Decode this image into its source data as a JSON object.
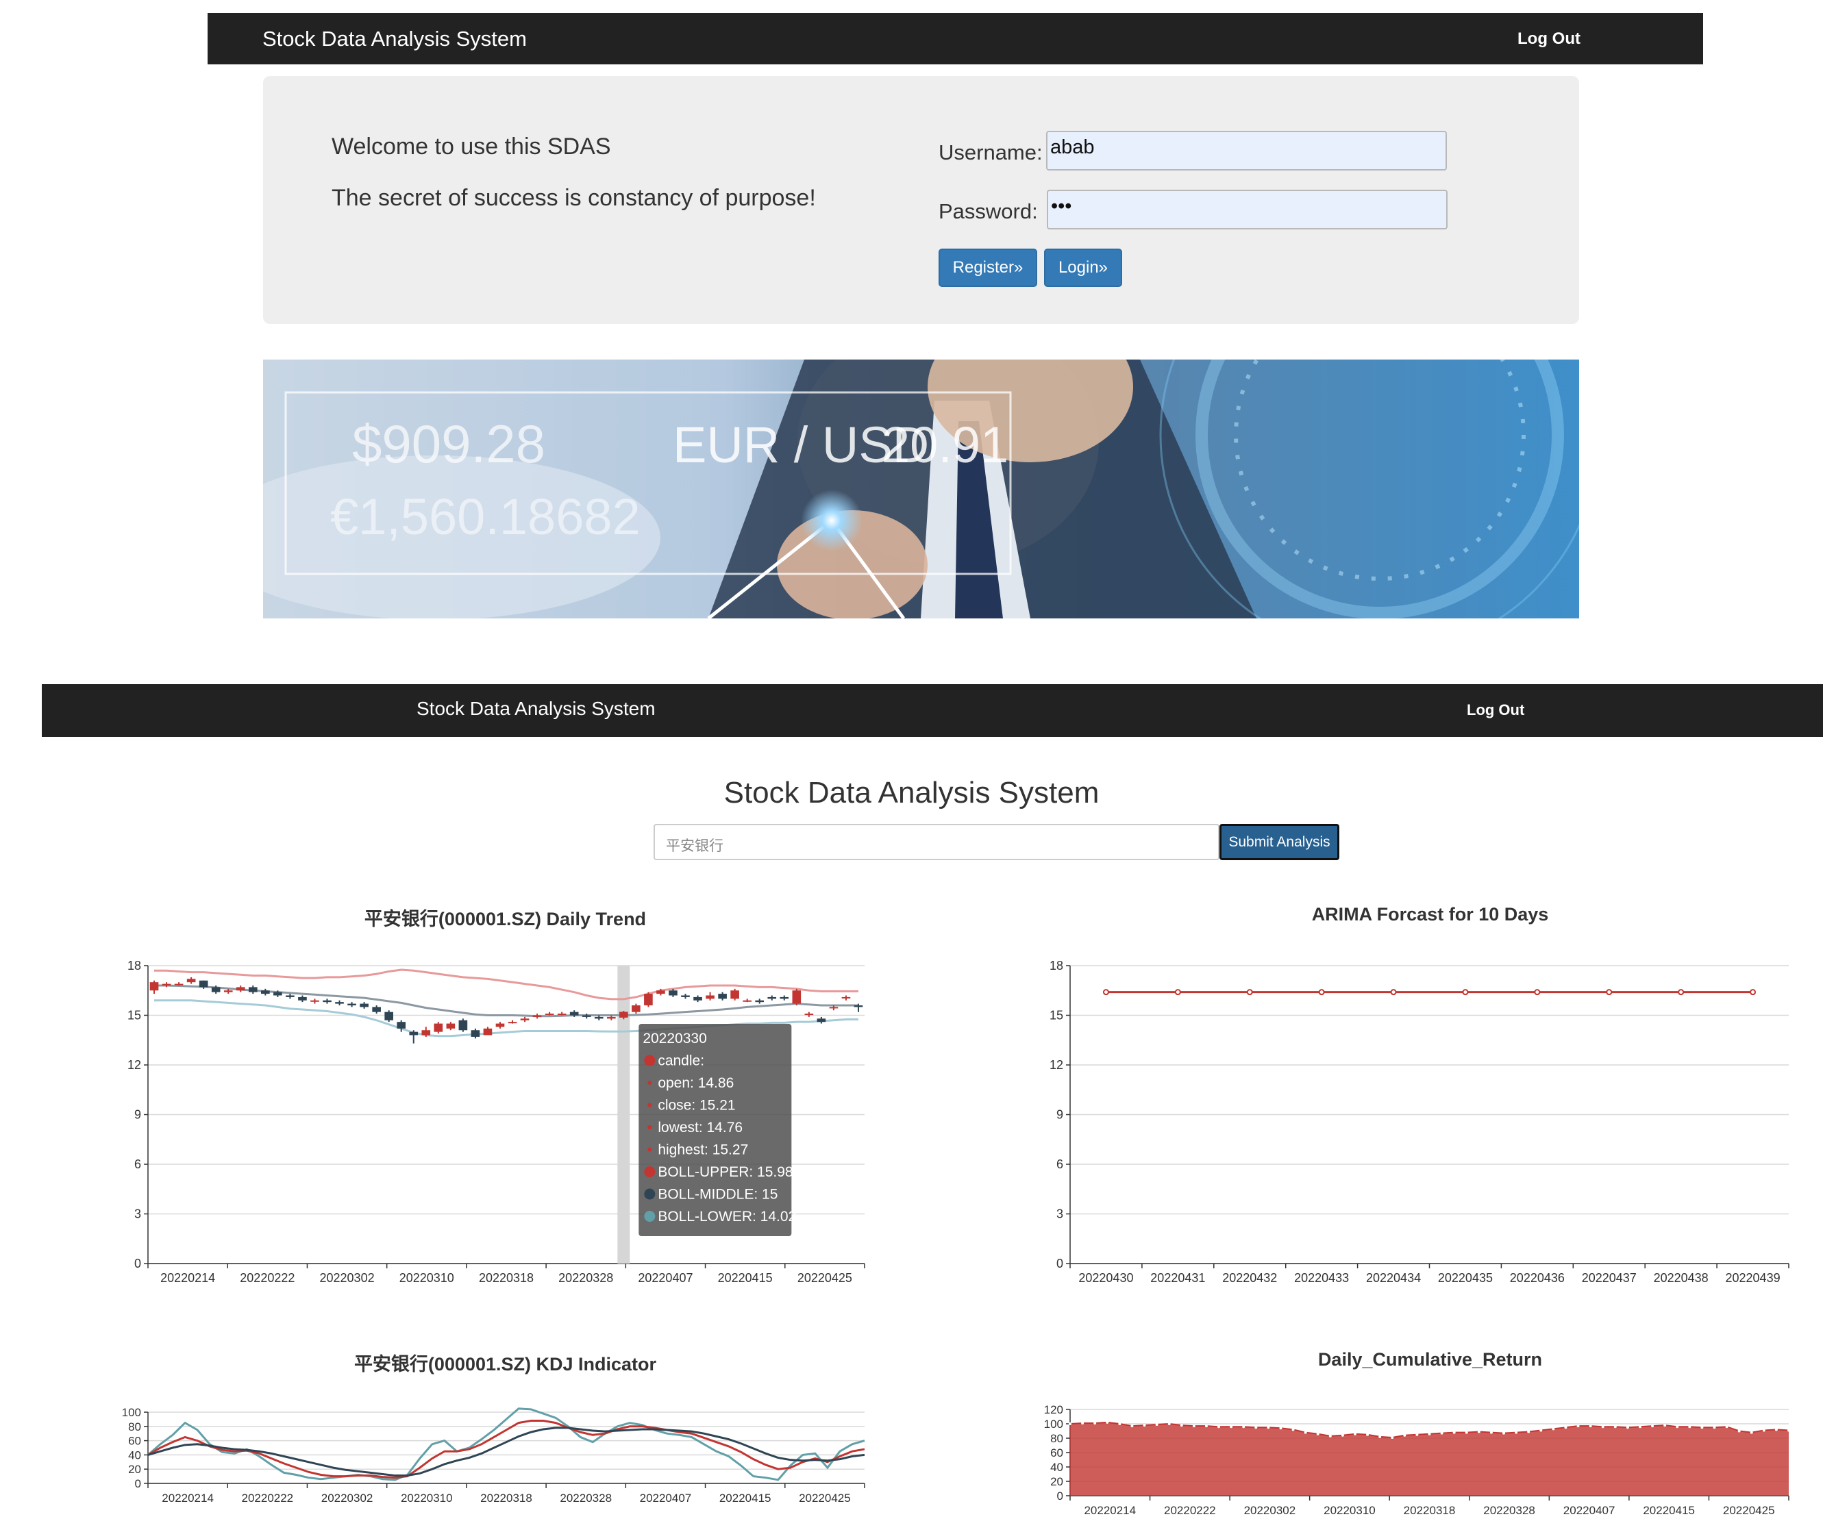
{
  "login_screen": {
    "navbar": {
      "brand": "Stock Data Analysis System",
      "logout": "Log Out"
    },
    "jumbotron": {
      "welcome": "Welcome to use this SDAS",
      "motto": "The secret of success is constancy of purpose!",
      "username_label": "Username:",
      "username_value": "abab",
      "password_label": "Password:",
      "password_value": "•••",
      "register_button": "Register»",
      "login_button": "Login»"
    },
    "banner": {
      "line1": "$909.28",
      "line2": "EUR / USD",
      "line3": "20.91",
      "line4": "€1,560.18682"
    }
  },
  "analysis_screen": {
    "navbar": {
      "brand": "Stock Data Analysis System",
      "logout": "Log Out"
    },
    "title": "Stock Data Analysis System",
    "search": {
      "value": "平安银行",
      "submit": "Submit Analysis"
    },
    "colors": {
      "red": "#c23531",
      "dark": "#2f4554",
      "teal": "#61a0a8",
      "upper": "#e8999a",
      "lower": "#a5cbd7",
      "middle": "#8c98a2"
    }
  },
  "chart_data": [
    {
      "type": "candlestick",
      "title": "平安银行(000001.SZ) Daily Trend",
      "xticks": [
        "20220214",
        "20220222",
        "20220302",
        "20220310",
        "20220318",
        "20220328",
        "20220407",
        "20220415",
        "20220425"
      ],
      "yticks": [
        "0",
        "3",
        "6",
        "9",
        "12",
        "15",
        "18"
      ],
      "ylim": [
        0,
        18
      ],
      "open": [
        16.5,
        16.8,
        16.9,
        17.0,
        17.1,
        16.7,
        16.4,
        16.5,
        16.7,
        16.5,
        16.4,
        16.2,
        16.1,
        15.9,
        15.9,
        15.8,
        15.7,
        15.7,
        15.5,
        15.2,
        14.6,
        14.0,
        13.8,
        14.0,
        14.2,
        14.7,
        14.1,
        13.8,
        14.3,
        14.6,
        14.7,
        14.9,
        15.1,
        15.1,
        15.2,
        15.0,
        14.9,
        14.8,
        14.86,
        15.2,
        15.6,
        16.3,
        16.5,
        16.2,
        16.1,
        16.0,
        16.3,
        16.0,
        15.9,
        15.9,
        16.1,
        16.1,
        15.7,
        15.1,
        14.8,
        15.5,
        16.1,
        15.6
      ],
      "close": [
        17.0,
        16.9,
        16.9,
        17.2,
        16.7,
        16.4,
        16.5,
        16.7,
        16.4,
        16.3,
        16.2,
        16.1,
        15.9,
        15.9,
        15.8,
        15.7,
        15.6,
        15.5,
        15.2,
        14.7,
        14.2,
        13.8,
        14.1,
        14.5,
        14.5,
        14.1,
        13.7,
        14.2,
        14.5,
        14.6,
        14.8,
        15.0,
        15.1,
        15.1,
        15.0,
        14.9,
        14.8,
        14.9,
        15.21,
        15.6,
        16.3,
        16.5,
        16.2,
        16.1,
        15.9,
        16.2,
        16.0,
        16.5,
        15.9,
        15.8,
        16.0,
        16.0,
        16.5,
        15.1,
        14.6,
        15.5,
        16.1,
        15.5
      ],
      "low": [
        16.3,
        16.7,
        16.8,
        16.9,
        16.6,
        16.3,
        16.3,
        16.4,
        16.3,
        16.2,
        16.1,
        16.0,
        15.8,
        15.7,
        15.7,
        15.6,
        15.5,
        15.4,
        15.1,
        14.6,
        14.0,
        13.3,
        13.7,
        13.9,
        14.1,
        14.0,
        13.6,
        13.8,
        14.2,
        14.5,
        14.6,
        14.8,
        15.0,
        15.0,
        14.9,
        14.8,
        14.7,
        14.7,
        14.76,
        15.1,
        15.5,
        16.2,
        16.1,
        16.0,
        15.8,
        15.9,
        15.9,
        15.9,
        15.8,
        15.7,
        15.9,
        15.9,
        15.6,
        14.9,
        14.5,
        15.3,
        15.9,
        15.2
      ],
      "high": [
        17.1,
        17.0,
        17.0,
        17.3,
        17.1,
        16.8,
        16.6,
        16.8,
        16.8,
        16.6,
        16.5,
        16.3,
        16.2,
        16.0,
        16.0,
        15.9,
        15.8,
        15.8,
        15.6,
        15.3,
        14.7,
        14.1,
        14.3,
        14.6,
        14.6,
        14.8,
        14.2,
        14.3,
        14.6,
        14.7,
        14.9,
        15.1,
        15.2,
        15.2,
        15.3,
        15.1,
        15.0,
        15.0,
        15.27,
        15.7,
        16.4,
        16.6,
        16.6,
        16.3,
        16.2,
        16.4,
        16.4,
        16.6,
        16.0,
        16.0,
        16.2,
        16.2,
        16.6,
        15.2,
        14.9,
        15.6,
        16.2,
        15.7
      ],
      "boll_upper": [
        17.7,
        17.7,
        17.65,
        17.6,
        17.6,
        17.55,
        17.5,
        17.45,
        17.4,
        17.4,
        17.35,
        17.3,
        17.25,
        17.25,
        17.3,
        17.3,
        17.35,
        17.4,
        17.5,
        17.65,
        17.75,
        17.7,
        17.6,
        17.5,
        17.4,
        17.3,
        17.25,
        17.2,
        17.1,
        17.0,
        16.9,
        16.8,
        16.7,
        16.55,
        16.4,
        16.2,
        16.05,
        15.98,
        15.98,
        16.1,
        16.3,
        16.5,
        16.6,
        16.7,
        16.75,
        16.8,
        16.8,
        16.8,
        16.75,
        16.7,
        16.7,
        16.65,
        16.6,
        16.5,
        16.45,
        16.45,
        16.45,
        16.45
      ],
      "boll_middle": [
        16.8,
        16.8,
        16.78,
        16.75,
        16.72,
        16.68,
        16.62,
        16.55,
        16.5,
        16.45,
        16.4,
        16.35,
        16.3,
        16.25,
        16.2,
        16.15,
        16.1,
        16.05,
        15.95,
        15.85,
        15.75,
        15.6,
        15.45,
        15.35,
        15.25,
        15.15,
        15.05,
        15.0,
        15.0,
        15.0,
        14.98,
        14.95,
        14.95,
        14.97,
        15.0,
        15.0,
        15.0,
        15.0,
        15.0,
        15.02,
        15.05,
        15.1,
        15.15,
        15.2,
        15.25,
        15.3,
        15.35,
        15.42,
        15.5,
        15.55,
        15.6,
        15.65,
        15.7,
        15.65,
        15.6,
        15.6,
        15.6,
        15.6
      ],
      "boll_lower": [
        15.9,
        15.9,
        15.9,
        15.9,
        15.85,
        15.8,
        15.75,
        15.7,
        15.65,
        15.6,
        15.5,
        15.4,
        15.35,
        15.3,
        15.25,
        15.15,
        15.05,
        14.9,
        14.7,
        14.45,
        14.2,
        13.95,
        13.8,
        13.75,
        13.75,
        13.8,
        13.85,
        13.9,
        13.95,
        14.0,
        14.05,
        14.05,
        14.05,
        14.05,
        14.05,
        14.05,
        14.03,
        14.02,
        14.02,
        14.05,
        14.1,
        14.15,
        14.2,
        14.25,
        14.3,
        14.35,
        14.4,
        14.45,
        14.5,
        14.5,
        14.55,
        14.55,
        14.6,
        14.6,
        14.65,
        14.7,
        14.75,
        14.75
      ],
      "tooltip": [
        "20220330",
        "candle:",
        "open: 14.86",
        "close: 15.21",
        "lowest: 14.76",
        "highest: 15.27",
        "BOLL-UPPER: 15.98",
        "BOLL-MIDDLE: 15",
        "BOLL-LOWER: 14.02"
      ],
      "tooltip_index": 38
    },
    {
      "type": "line",
      "title": "ARIMA Forcast for 10 Days",
      "categories": [
        "20220430",
        "20220431",
        "20220432",
        "20220433",
        "20220434",
        "20220435",
        "20220436",
        "20220437",
        "20220438",
        "20220439"
      ],
      "values": [
        16.4,
        16.4,
        16.4,
        16.4,
        16.4,
        16.4,
        16.4,
        16.4,
        16.4,
        16.4
      ],
      "yticks": [
        "0",
        "3",
        "6",
        "9",
        "12",
        "15",
        "18"
      ],
      "ylim": [
        0,
        18
      ]
    },
    {
      "type": "line",
      "title": "平安银行(000001.SZ) KDJ Indicator",
      "xticks": [
        "20220214",
        "20220222",
        "20220302",
        "20220310",
        "20220318",
        "20220328",
        "20220407",
        "20220415",
        "20220425"
      ],
      "yticks": [
        "0",
        "20",
        "40",
        "60",
        "80",
        "100"
      ],
      "ylim": [
        0,
        100
      ],
      "series": [
        {
          "values": [
            40,
            55,
            68,
            85,
            75,
            55,
            44,
            42,
            48,
            38,
            26,
            15,
            12,
            8,
            6,
            8,
            10,
            12,
            10,
            6,
            5,
            12,
            35,
            55,
            60,
            45,
            50,
            62,
            75,
            90,
            105,
            104,
            98,
            92,
            80,
            65,
            58,
            70,
            80,
            85,
            82,
            75,
            70,
            68,
            65,
            55,
            45,
            38,
            25,
            10,
            8,
            5,
            25,
            40,
            42,
            22,
            45,
            55,
            60
          ]
        },
        {
          "values": [
            40,
            50,
            58,
            65,
            60,
            52,
            47,
            45,
            46,
            42,
            35,
            28,
            22,
            16,
            12,
            10,
            10,
            11,
            11,
            9,
            8,
            10,
            22,
            35,
            45,
            45,
            48,
            55,
            65,
            75,
            85,
            88,
            88,
            85,
            78,
            72,
            68,
            70,
            76,
            80,
            80,
            78,
            75,
            72,
            70,
            64,
            58,
            52,
            44,
            34,
            26,
            20,
            22,
            30,
            35,
            30,
            38,
            45,
            48
          ]
        },
        {
          "values": [
            40,
            45,
            50,
            54,
            55,
            53,
            50,
            48,
            47,
            45,
            42,
            38,
            34,
            30,
            26,
            22,
            19,
            17,
            15,
            13,
            11,
            11,
            14,
            20,
            27,
            32,
            36,
            42,
            50,
            58,
            66,
            72,
            76,
            78,
            78,
            76,
            74,
            73,
            74,
            75,
            76,
            76,
            75,
            74,
            73,
            70,
            66,
            62,
            56,
            49,
            42,
            36,
            33,
            32,
            33,
            32,
            34,
            38,
            40
          ]
        }
      ]
    },
    {
      "type": "area",
      "title": "Daily_Cumulative_Return",
      "xticks": [
        "20220214",
        "20220222",
        "20220302",
        "20220310",
        "20220318",
        "20220328",
        "20220407",
        "20220415",
        "20220425"
      ],
      "yticks": [
        "0",
        "20",
        "40",
        "60",
        "80",
        "100",
        "120"
      ],
      "ylim": [
        0,
        120
      ],
      "values": [
        100,
        101,
        101,
        102,
        100,
        97,
        98,
        99,
        100,
        98,
        97,
        97,
        96,
        96,
        96,
        95,
        95,
        94,
        92,
        88,
        86,
        83,
        84,
        86,
        85,
        82,
        81,
        84,
        85,
        86,
        87,
        88,
        88,
        89,
        88,
        87,
        88,
        89,
        91,
        93,
        95,
        97,
        97,
        96,
        96,
        95,
        96,
        97,
        98,
        96,
        96,
        95,
        95,
        96,
        90,
        88,
        91,
        92,
        91
      ]
    }
  ]
}
